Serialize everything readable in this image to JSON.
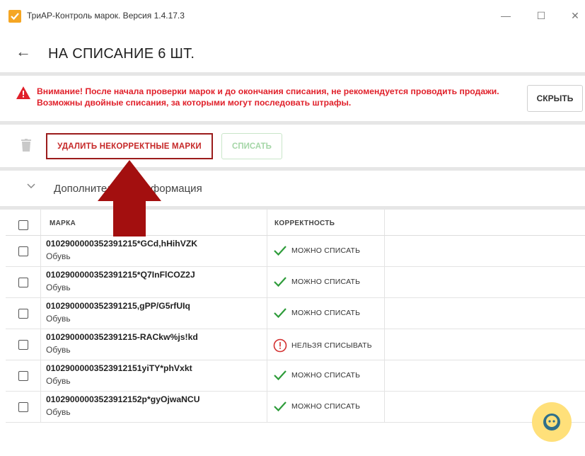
{
  "window": {
    "title": "ТриАР-Контроль марок. Версия 1.4.17.3",
    "min_glyph": "—",
    "max_glyph": "☐",
    "close_glyph": "✕"
  },
  "header": {
    "back_glyph": "←",
    "title": "НА СПИСАНИЕ 6 ШТ."
  },
  "warning": {
    "text": "Внимание! После начала проверки марок и до окончания списания, не рекомендуется проводить продажи. Возможны двойные списания, за которыми могут последовать штрафы.",
    "hide_label": "СКРЫТЬ",
    "color": "#e0202a"
  },
  "toolbar": {
    "delete_invalid_label": "УДАЛИТЬ НЕКОРРЕКТНЫЕ МАРКИ",
    "write_off_label": "СПИСАТЬ"
  },
  "additional_info": {
    "label": "Дополнительная информация"
  },
  "table": {
    "columns": [
      "МАРКА",
      "КОРРЕКТНОСТЬ"
    ],
    "rows": [
      {
        "mark": "0102900000352391215*GCd,hHihVZK",
        "type": "Обувь",
        "status": "МОЖНО СПИСАТЬ",
        "ok": true
      },
      {
        "mark": "0102900000352391215*Q7InFlCOZ2J",
        "type": "Обувь",
        "status": "МОЖНО СПИСАТЬ",
        "ok": true
      },
      {
        "mark": "0102900000352391215,gPP/G5rfUIq",
        "type": "Обувь",
        "status": "МОЖНО СПИСАТЬ",
        "ok": true
      },
      {
        "mark": "0102900000352391215-RACkw%js!kd",
        "type": "Обувь",
        "status": "НЕЛЬЗЯ СПИСЫВАТЬ",
        "ok": false
      },
      {
        "mark": "01029000003523912151yiTY*phVxkt",
        "type": "Обувь",
        "status": "МОЖНО СПИСАТЬ",
        "ok": true
      },
      {
        "mark": "01029000003523912152p*gyOjwaNCU",
        "type": "Обувь",
        "status": "МОЖНО СПИСАТЬ",
        "ok": true
      }
    ]
  },
  "colors": {
    "accent": "#f5a623",
    "ok": "#2e9c3a",
    "error": "#d32f2f",
    "highlight_box": "#9b1c1c",
    "overlay_arrow": "#a30f0f",
    "assistant_bg": "#ffe07a"
  },
  "icons": {
    "app": "checkmark-logo-icon",
    "warning": "warning-triangle-icon",
    "trash": "trash-icon",
    "chevron": "chevron-down-icon",
    "ok_status": "checkmark-icon",
    "error_status": "exclamation-circle-icon",
    "assistant": "chat-bot-icon"
  }
}
